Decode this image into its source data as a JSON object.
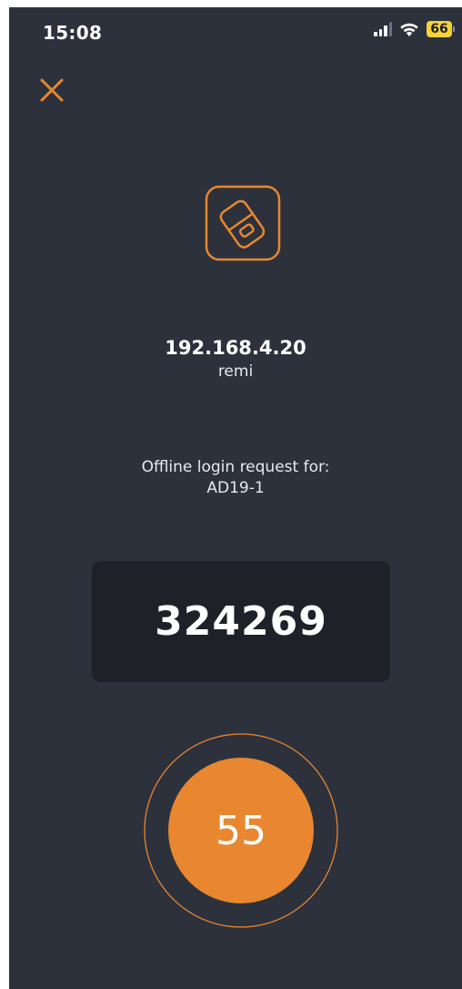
{
  "status_bar": {
    "time": "15:08",
    "battery": "66",
    "icons": [
      "signal-icon",
      "wifi-icon",
      "battery-icon"
    ]
  },
  "header": {
    "close_icon": "close-icon"
  },
  "request": {
    "device_icon": "device-key-icon",
    "host": "192.168.4.20",
    "user": "remi",
    "label": "Offline login request for:",
    "target": "AD19-1"
  },
  "code": {
    "value": "324269"
  },
  "timer": {
    "seconds": "55",
    "progress": 1.0
  },
  "colors": {
    "background": "#2c313c",
    "accent": "#e8872f",
    "code_box": "#1f2129",
    "battery": "#f3d23a"
  }
}
